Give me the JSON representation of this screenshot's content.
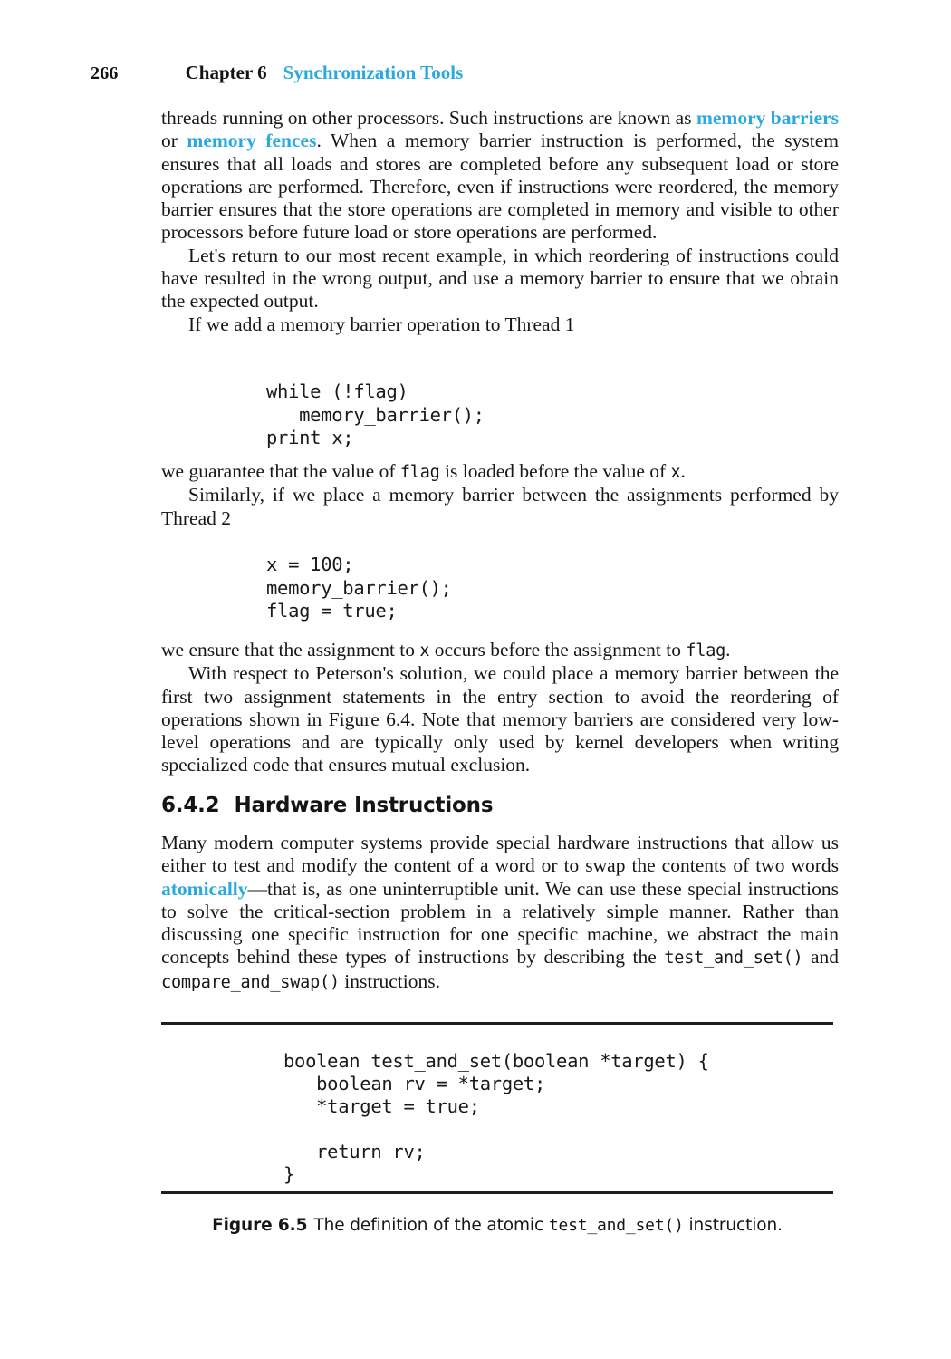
{
  "page": {
    "folio": "266",
    "chapter_label": "Chapter 6",
    "chapter_title": "Synchronization Tools",
    "accent_color": "#29a9e0",
    "text_color": "#171717"
  },
  "paragraphs": {
    "p1_a": "threads running on other processors. Such instructions are known as ",
    "p1_term1": "memory barriers",
    "p1_b": " or ",
    "p1_term2": "memory fences",
    "p1_c": ". When a memory barrier instruction is performed, the system ensures that all loads and stores are completed before any subsequent load or store operations are performed. Therefore, even if instructions were reordered, the memory barrier ensures that the store operations are completed in memory and visible to other processors before future load or store operations are performed.",
    "p2": "Let's return to our most recent example, in which reordering of instructions could have resulted in the wrong output, and use a memory barrier to ensure that we obtain the expected output.",
    "p3": "If we add a memory barrier operation to Thread 1",
    "p4_a": "we guarantee that the value of ",
    "p4_code1": "flag",
    "p4_b": " is loaded before the value of ",
    "p4_code2": "x",
    "p4_c": ".",
    "p5": "Similarly, if we place a memory barrier between the assignments performed by Thread 2",
    "p6_a": "we ensure that the assignment to ",
    "p6_code1": "x",
    "p6_b": " occurs before the assignment to ",
    "p6_code2": "flag",
    "p6_c": ".",
    "p7": "With respect to Peterson's solution, we could place a memory barrier between the first two assignment statements in the entry section to avoid the reordering of operations shown in Figure 6.4. Note that memory barriers are considered very low-level operations and are typically only used by kernel developers when writing specialized code that ensures mutual exclusion.",
    "p8_a": "Many modern computer systems provide special hardware instructions that allow us either to test and modify the content of a word or to swap the contents of two words ",
    "p8_term1": "atomically",
    "p8_b": "—that is, as one uninterruptible unit. We can use these special instructions to solve the critical-section problem in a relatively simple manner. Rather than discussing one specific instruction for one specific machine, we abstract the main concepts behind these types of instructions by describing the ",
    "p8_code1": "test_and_set()",
    "p8_c": " and ",
    "p8_code2": "compare_and_swap()",
    "p8_d": " instructions."
  },
  "section": {
    "number": "6.4.2",
    "title": "Hardware Instructions"
  },
  "code_blocks": {
    "thread1": "while (!flag)\n   memory_barrier();\nprint x;",
    "thread2": "x = 100;\nmemory_barrier();\nflag = true;"
  },
  "figure": {
    "code": "boolean test_and_set(boolean *target) {\n   boolean rv = *target;\n   *target = true;\n\n   return rv;\n}",
    "caption_label": "Figure 6.5",
    "caption_a": "The definition of the atomic ",
    "caption_code": "test_and_set()",
    "caption_b": " instruction."
  }
}
